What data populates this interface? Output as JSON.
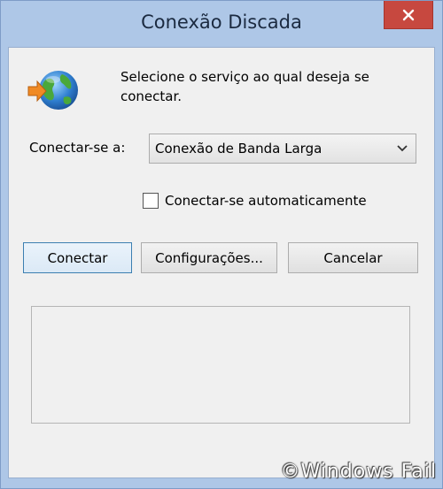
{
  "window": {
    "title": "Conexão Discada",
    "close_icon": "close-icon"
  },
  "dialog": {
    "prompt": "Selecione o serviço ao qual deseja se conectar.",
    "connect_to_label": "Conectar-se a:",
    "connect_to_selected": "Conexão de Banda Larga",
    "auto_connect_label": "Conectar-se automaticamente",
    "auto_connect_checked": false
  },
  "buttons": {
    "connect": "Conectar",
    "settings": "Configurações...",
    "cancel": "Cancelar"
  },
  "watermark": "©Windows Fail",
  "colors": {
    "titlebar": "#aec7e7",
    "close_button": "#c7483f",
    "client_bg": "#f0f0f0",
    "default_button_border": "#3c7fb1"
  }
}
